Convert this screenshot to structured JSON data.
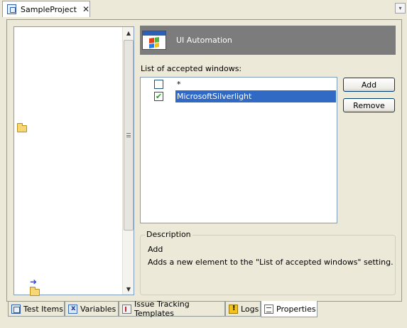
{
  "top_tab": {
    "label": "SampleProject",
    "close_glyph": "✕",
    "icon": "project-icon"
  },
  "dropdown_glyph": "▾",
  "sidebar": {
    "scroll_up_glyph": "▲",
    "scroll_down_glyph": "▼",
    "icons": [
      "folder-icon",
      "blue-arrow-icon",
      "folder-icon"
    ]
  },
  "header": {
    "title": "UI Automation",
    "icon": "windows-logo-icon"
  },
  "list": {
    "label": "List of accepted windows:",
    "items": [
      {
        "text": "*",
        "checked": false,
        "selected": false
      },
      {
        "text": "MicrosoftSilverlight",
        "checked": true,
        "selected": true
      }
    ],
    "check_glyph": "✔"
  },
  "buttons": {
    "add": "Add",
    "remove": "Remove"
  },
  "description": {
    "legend": "Description",
    "title": "Add",
    "text": "Adds a new element to the \"List of accepted windows\" setting."
  },
  "bottom_tabs": [
    {
      "label": "Test Items",
      "icon": "test-items-icon",
      "active": false
    },
    {
      "label": "Variables",
      "icon": "variables-icon",
      "active": false
    },
    {
      "label": "Issue Tracking Templates",
      "icon": "issue-tracking-icon",
      "active": false
    },
    {
      "label": "Logs",
      "icon": "logs-icon",
      "active": false
    },
    {
      "label": "Properties",
      "icon": "properties-icon",
      "active": true
    }
  ],
  "colors": {
    "background": "#ece9d8",
    "header_bar": "#7c7c7c",
    "selection": "#316ac5",
    "checkbox_check": "#21a121"
  }
}
